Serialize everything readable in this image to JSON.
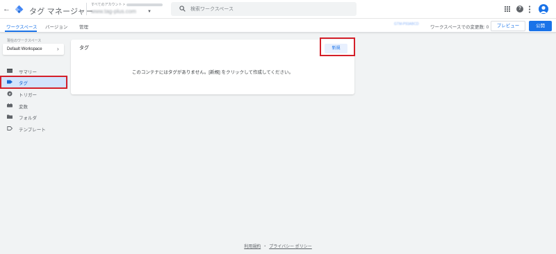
{
  "header": {
    "back_glyph": "←",
    "app_title": "タグ マネージャー",
    "account_crumb": "すべてのアカウント >",
    "container_name": "www.tag-plus.com",
    "search_placeholder": "検索ワークスペース",
    "help_glyph": "?"
  },
  "subnav": {
    "tabs": [
      "ワークスペース",
      "バージョン",
      "管理"
    ],
    "container_id": "GTM-P93ABCD",
    "changes_text": "ワークスペースでの変更数: 0",
    "preview_label": "プレビュー",
    "publish_label": "公開"
  },
  "sidebar": {
    "workspace_label": "現在のワークスペース",
    "workspace_name": "Default Workspace",
    "chevron_glyph": "›",
    "items": [
      {
        "label": "サマリー",
        "icon": "summary-icon",
        "active": false
      },
      {
        "label": "タグ",
        "icon": "tag-icon",
        "active": true
      },
      {
        "label": "トリガー",
        "icon": "trigger-icon",
        "active": false
      },
      {
        "label": "変数",
        "icon": "variables-icon",
        "active": false
      },
      {
        "label": "フォルダ",
        "icon": "folder-icon",
        "active": false
      },
      {
        "label": "テンプレート",
        "icon": "template-icon",
        "active": false
      }
    ]
  },
  "main": {
    "card_title": "タグ",
    "new_button_label": "新規",
    "empty_message": "このコンテナにはタグがありません。[新規] をクリックして作成してください。"
  },
  "footer": {
    "terms_label": "利用規約",
    "separator": "・",
    "privacy_label": "プライバシー ポリシー"
  },
  "colors": {
    "accent": "#1a73e8",
    "highlight": "#d41f29",
    "active_nav_bg": "#d2e3fc"
  }
}
